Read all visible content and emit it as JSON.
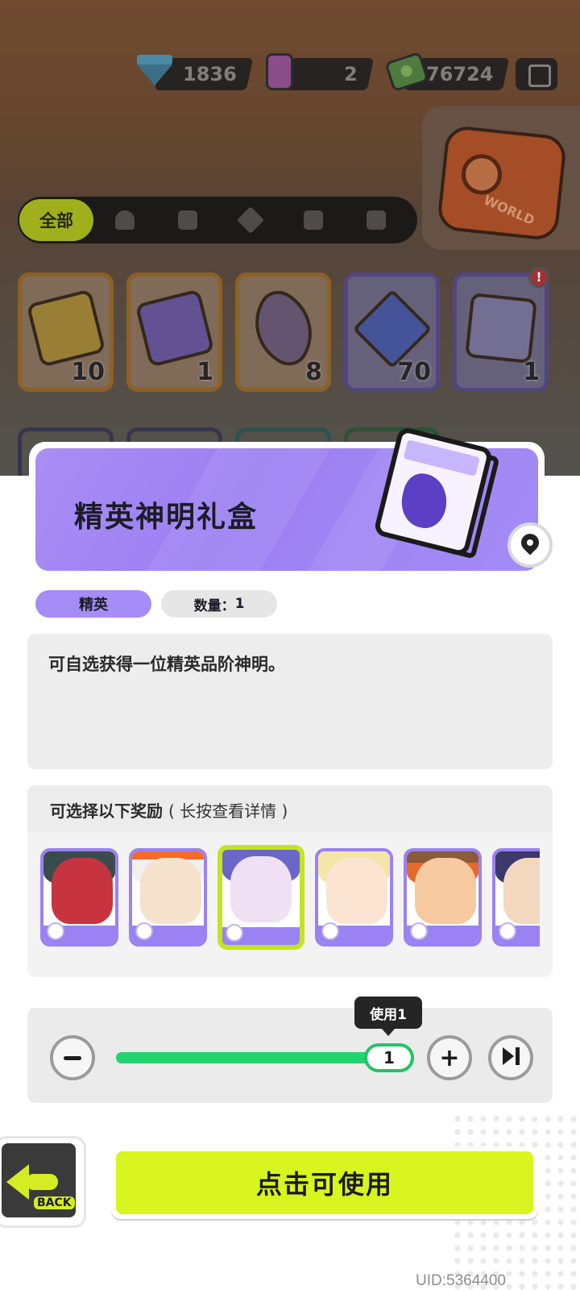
{
  "currencies": [
    {
      "name": "diamond-icon",
      "value": "1836"
    },
    {
      "name": "spray-can-icon",
      "value": "2"
    },
    {
      "name": "cash-icon",
      "value": "76724"
    }
  ],
  "filter_tabs": {
    "all_label": "全部",
    "icons": [
      "person-icon",
      "box-icon",
      "spray-icon",
      "card-icon",
      "book-icon"
    ]
  },
  "world_button": {
    "label": "WORLD"
  },
  "inventory": [
    {
      "icon": "gold-ticket-icon",
      "count": "10"
    },
    {
      "icon": "purple-ticket-icon",
      "count": "1"
    },
    {
      "icon": "rainbow-star-icon",
      "count": "8"
    },
    {
      "icon": "blue-star-icon",
      "count": "70"
    },
    {
      "icon": "elite-box-icon",
      "count": "1",
      "badge": "!"
    }
  ],
  "item": {
    "title": "精英神明礼盒",
    "rarity": "精英",
    "quantity_label": "数量：",
    "quantity": "1",
    "description": "可自选获得一位精英品阶神明。"
  },
  "rewards": {
    "heading": "可选择以下奖励",
    "hint": "( 长按查看详情 )",
    "heroes": [
      {
        "name": "hero-1",
        "selected": false
      },
      {
        "name": "hero-2",
        "selected": false
      },
      {
        "name": "hero-3",
        "selected": true
      },
      {
        "name": "hero-4",
        "selected": false
      },
      {
        "name": "hero-5",
        "selected": false
      },
      {
        "name": "hero-6",
        "selected": false
      }
    ]
  },
  "use_control": {
    "tooltip": "使用1",
    "value": "1",
    "progress": 1.0
  },
  "buttons": {
    "back_label": "BACK",
    "action_label": "点击可使用"
  },
  "uid": "UID:5364400",
  "colors": {
    "accent_purple": "#a58cf6",
    "accent_lime": "#d8f51f",
    "slider_green": "#22d46f"
  }
}
